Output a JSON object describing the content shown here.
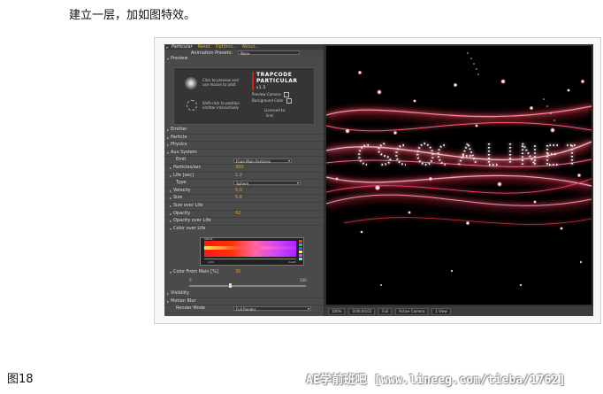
{
  "caption_top": "建立一层，加如图特效。",
  "caption_bottom": "图18",
  "watermark": "AE学前班吧 [www.lineeg.com/tieba/1762]",
  "panel": {
    "effect_name": "Particular",
    "links": [
      "Reset",
      "Options...",
      "About..."
    ],
    "animation_presets_label": "Animation Presets:",
    "animation_presets_value": "None",
    "preview_label": "Preview",
    "preview_hint_1": "Click to preview and use mouse to orbit",
    "preview_hint_2": "Shift-click to position emitter interactively",
    "brand_line1": "TRAPCODE",
    "brand_line2": "PARTICULAR",
    "brand_version": "v1.5",
    "preview_camera": "Preview Camera",
    "background_color": "Background Color",
    "licensed_to": "Licensed to:",
    "licensee": "linni",
    "rows": [
      {
        "label": "Emitter",
        "twirl": "▸"
      },
      {
        "label": "Particle",
        "twirl": "▸"
      },
      {
        "label": "Physics",
        "twirl": "▸"
      },
      {
        "label": "Aux System",
        "twirl": "▾"
      }
    ],
    "aux": {
      "emit_label": "Emit",
      "emit_value": "From Main Particles",
      "particles_sec_label": "Particles/sec",
      "particles_sec_value": "300",
      "life_label": "Life [sec]",
      "life_value": "1.2",
      "type_label": "Type",
      "type_value": "Sphere",
      "velocity_label": "Velocity",
      "velocity_value": "0.0",
      "size_label": "Size",
      "size_value": "5.8",
      "size_over_life_label": "Size over Life",
      "opacity_label": "Opacity",
      "opacity_value": "42",
      "opacity_over_life_label": "Opacity over Life",
      "color_over_life_label": "Color over Life",
      "grad_top_label": "SPACE",
      "grad_top_label2": "BLEND",
      "grad_left": "birth",
      "grad_right": "death",
      "color_from_main_label": "Color From Main [%]",
      "color_from_main_value": "35",
      "slider_min": "0",
      "slider_max": "100",
      "color_from_main_fraction": 0.35
    },
    "tail_rows": [
      {
        "label": "Visibility",
        "twirl": "▸"
      },
      {
        "label": "Motion Blur",
        "twirl": "▸"
      }
    ],
    "render_mode_label": "Render Mode",
    "render_mode_value": "Full Render"
  },
  "comp_bar": [
    "100%",
    "0;00;00;02",
    "Full",
    "Active Camera",
    "1 View"
  ],
  "colors": {
    "panel_bg": "#4a4a4a",
    "value_orange": "#e8a020",
    "viewer_bg": "#000000",
    "glow_red": "#ff2a3a",
    "glow_pink": "#ff9ab0"
  }
}
